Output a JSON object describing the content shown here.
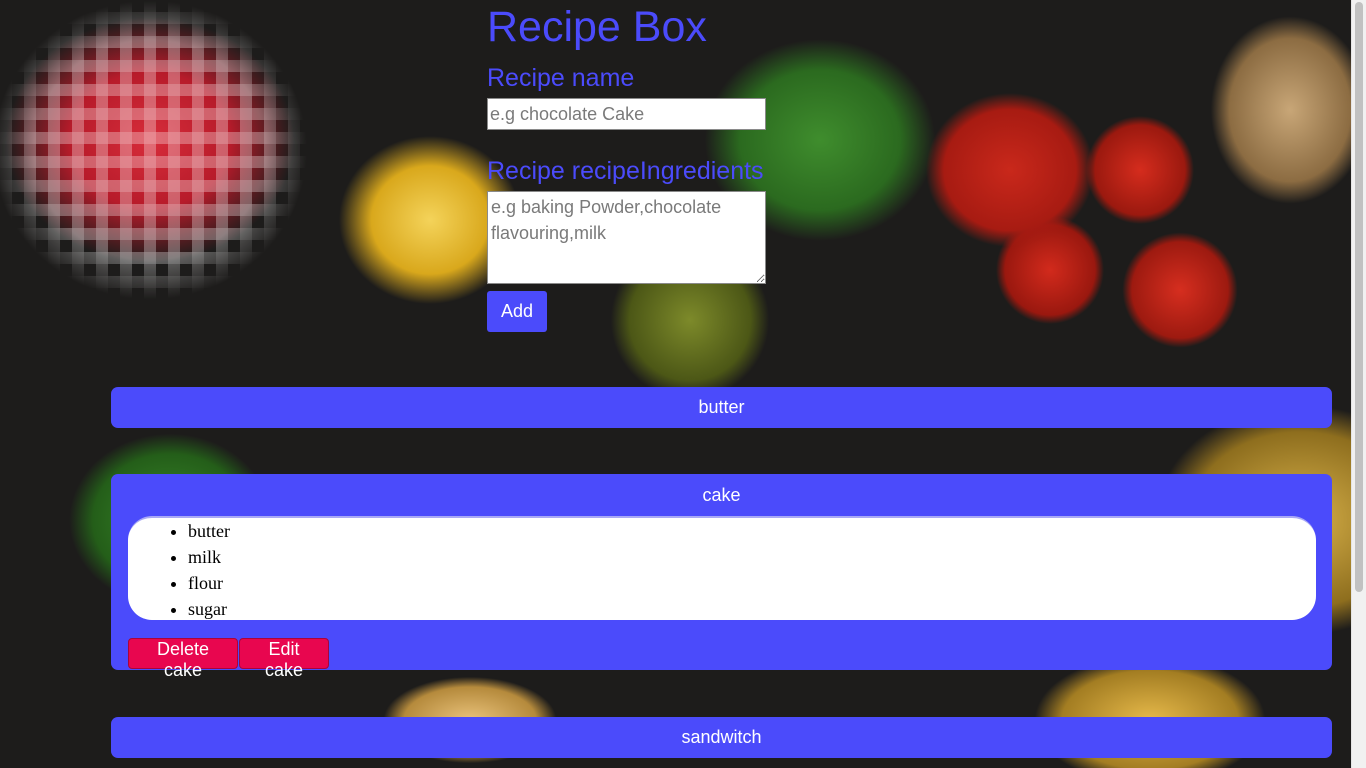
{
  "app": {
    "title": "Recipe Box"
  },
  "form": {
    "name_label": "Recipe name",
    "name_placeholder": "e.g chocolate Cake",
    "name_value": "",
    "ingredients_label": "Recipe recipeIngredients",
    "ingredients_placeholder": "e.g baking Powder,chocolate flavouring,milk",
    "ingredients_value": "",
    "add_label": "Add"
  },
  "recipes": [
    {
      "name": "butter",
      "expanded": false
    },
    {
      "name": "cake",
      "expanded": true,
      "ingredients": [
        "butter",
        "milk",
        "flour",
        "sugar"
      ],
      "delete_label": "Delete cake",
      "edit_label": "Edit cake"
    },
    {
      "name": "sandwitch",
      "expanded": false
    }
  ],
  "colors": {
    "accent": "#4b4bfb",
    "danger": "#e8064f",
    "panel_text": "#ffffff"
  }
}
